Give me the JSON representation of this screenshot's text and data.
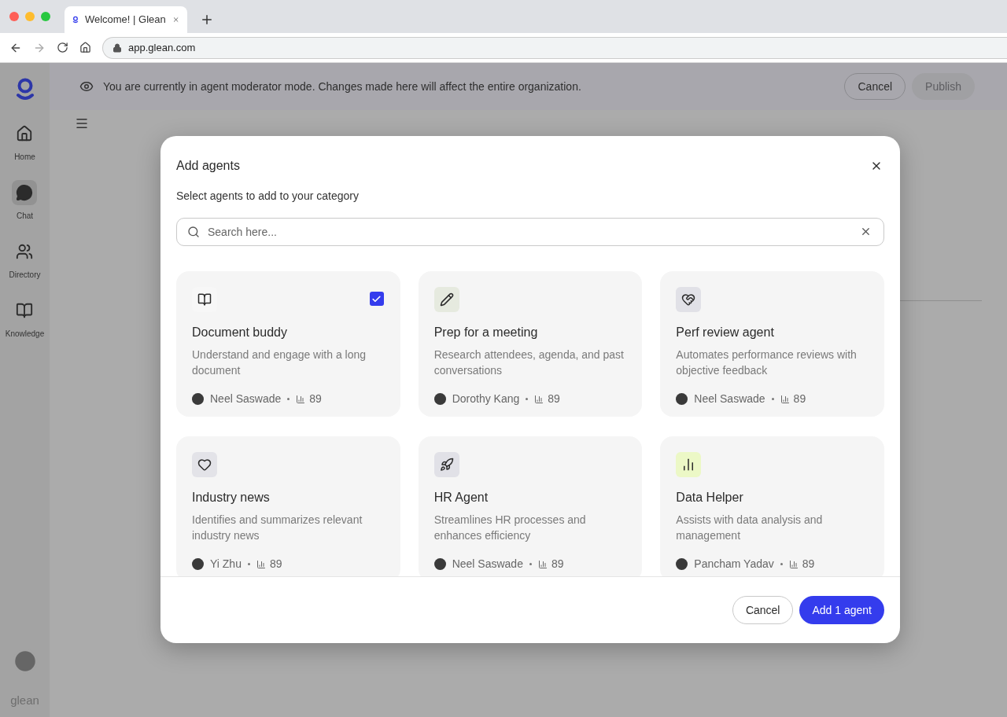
{
  "browser": {
    "tab_title": "Welcome! | Glean",
    "url": "app.glean.com"
  },
  "sidebar": {
    "items": [
      {
        "label": "Home",
        "selected": false
      },
      {
        "label": "Chat",
        "selected": true
      },
      {
        "label": "Directory",
        "selected": false
      },
      {
        "label": "Knowledge",
        "selected": false
      }
    ],
    "footer_logo": "glean"
  },
  "banner": {
    "message": "You are currently in agent moderator mode. Changes made here will affect the entire organization.",
    "buttons": [
      {
        "label": "Cancel",
        "disabled": false
      },
      {
        "label": "Publish",
        "disabled": true
      }
    ]
  },
  "dialog": {
    "title": "Add agents",
    "subtitle": "Select agents to add to your category",
    "search": {
      "placeholder": "Search here..."
    },
    "agents": [
      {
        "name": "Document buddy",
        "description": "Understand and engage with a long document",
        "author": "Neel Saswade",
        "count": "89",
        "color": "#f7f7f7",
        "selected": true
      },
      {
        "name": "Prep for a meeting",
        "description": "Research attendees, agenda, and past conversations",
        "author": "Dorothy Kang",
        "count": "89",
        "color": "#e6eadf",
        "selected": false
      },
      {
        "name": "Perf review agent",
        "description": "Automates performance reviews with objective feedback",
        "author": "Neel Saswade",
        "count": "89",
        "color": "#e1e1e7",
        "selected": false
      },
      {
        "name": "Industry news",
        "description": "Identifies and summarizes relevant industry news",
        "author": "Yi Zhu",
        "count": "89",
        "color": "#e3e3e8",
        "selected": false
      },
      {
        "name": "HR Agent",
        "description": "Streamlines HR processes and enhances efficiency",
        "author": "Neel Saswade",
        "count": "89",
        "color": "#e1e1e7",
        "selected": false
      },
      {
        "name": "Data Helper",
        "description": "Assists with data analysis and management",
        "author": "Pancham Yadav",
        "count": "89",
        "color": "#ecf8c6",
        "selected": false
      }
    ],
    "buttons": [
      {
        "label": "Cancel",
        "kind": "secondary"
      },
      {
        "label": "Add 1 agent",
        "kind": "primary"
      }
    ]
  }
}
